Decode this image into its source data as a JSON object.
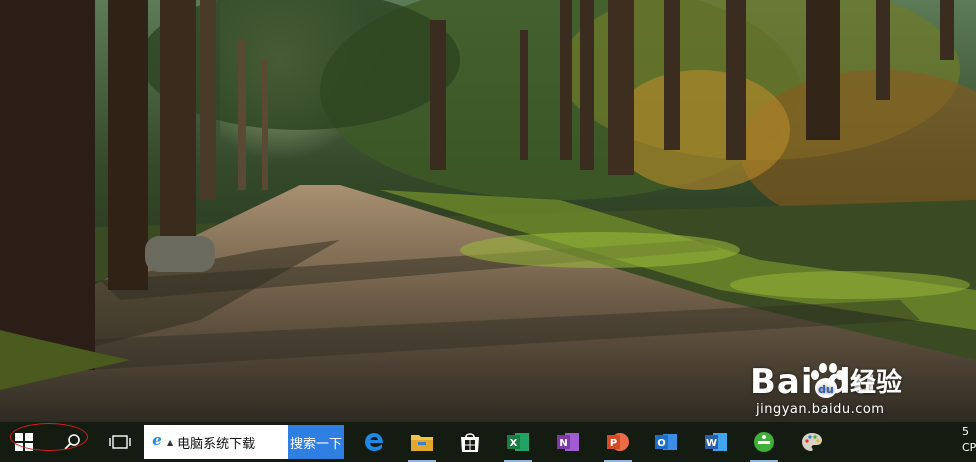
{
  "search": {
    "value": "电脑系统下载",
    "button_label": "搜索一下"
  },
  "taskbar": {
    "start_icon": "windows-logo-icon",
    "search_icon": "magnifier-icon",
    "task_view_icon": "task-view-icon",
    "highlight_color": "#d81e1e",
    "pinned_apps": [
      {
        "name": "edge",
        "icon": "edge-icon",
        "color": "#1e88e5"
      },
      {
        "name": "file-explorer",
        "icon": "folder-icon",
        "color": "#f3c44a"
      },
      {
        "name": "store",
        "icon": "store-icon",
        "color": "#ffffff"
      },
      {
        "name": "excel",
        "icon": "excel-icon",
        "color": "#1f7a44"
      },
      {
        "name": "onenote",
        "icon": "onenote-icon",
        "color": "#7b3aa8"
      },
      {
        "name": "powerpoint",
        "icon": "powerpoint-icon",
        "color": "#d24a26"
      },
      {
        "name": "outlook",
        "icon": "outlook-icon",
        "color": "#1e6fc2"
      },
      {
        "name": "word",
        "icon": "word-icon",
        "color": "#2b5eab"
      },
      {
        "name": "green-app",
        "icon": "green-circle-icon",
        "color": "#3fae3a"
      },
      {
        "name": "paint",
        "icon": "palette-icon",
        "color": "#d8d2c4"
      }
    ]
  },
  "tray": {
    "line1": "5",
    "line2": "CPU"
  },
  "watermark": {
    "brand": "Bai du",
    "product": "经验",
    "url": "jingyan.baidu.com"
  }
}
